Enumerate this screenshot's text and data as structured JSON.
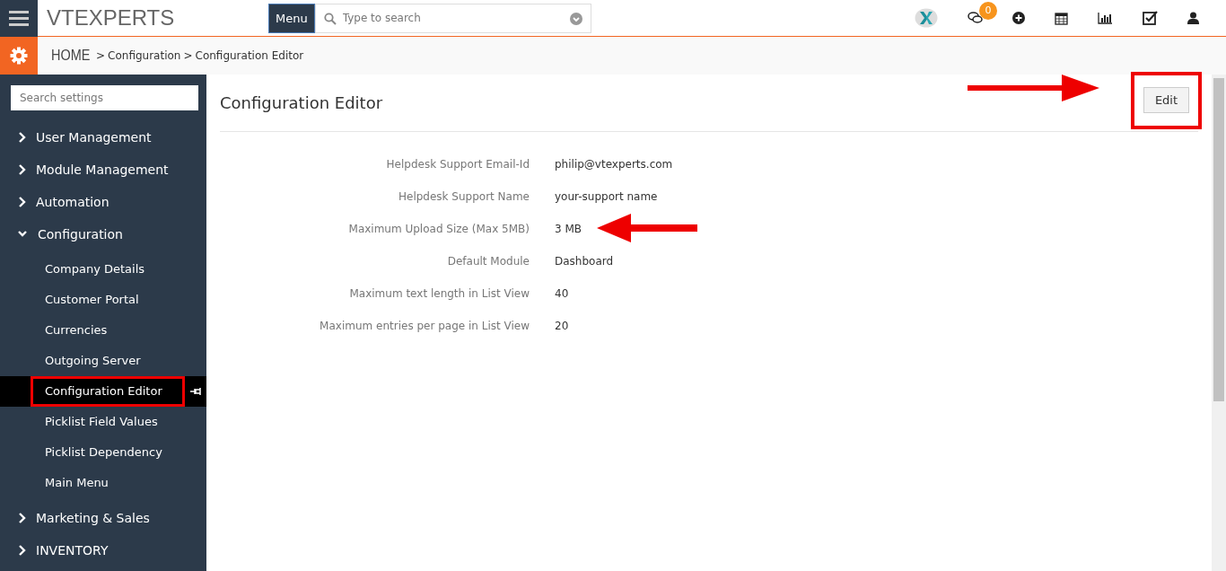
{
  "header": {
    "logo": "VTEXPERTS",
    "menu_button": "Menu",
    "search": {
      "placeholder": "Type to search"
    },
    "notification_count": "0"
  },
  "breadcrumb": {
    "home": "HOME",
    "separator": ">",
    "items": [
      "Configuration",
      "Configuration Editor"
    ]
  },
  "sidebar": {
    "search": {
      "placeholder": "Search settings"
    },
    "sections": [
      {
        "label": "User Management",
        "expanded": false
      },
      {
        "label": "Module Management",
        "expanded": false
      },
      {
        "label": "Automation",
        "expanded": false
      },
      {
        "label": "Configuration",
        "expanded": true,
        "children": [
          {
            "label": "Company Details",
            "selected": false
          },
          {
            "label": "Customer Portal",
            "selected": false
          },
          {
            "label": "Currencies",
            "selected": false
          },
          {
            "label": "Outgoing Server",
            "selected": false
          },
          {
            "label": "Configuration Editor",
            "selected": true
          },
          {
            "label": "Picklist Field Values",
            "selected": false
          },
          {
            "label": "Picklist Dependency",
            "selected": false
          },
          {
            "label": "Main Menu",
            "selected": false
          }
        ]
      },
      {
        "label": "Marketing & Sales",
        "expanded": false
      },
      {
        "label": "INVENTORY",
        "expanded": false
      }
    ]
  },
  "page": {
    "title": "Configuration Editor",
    "edit_button": "Edit",
    "fields": [
      {
        "label": "Helpdesk Support Email-Id",
        "value": "philip@vtexperts.com"
      },
      {
        "label": "Helpdesk Support Name",
        "value": "your-support name"
      },
      {
        "label": "Maximum Upload Size (Max 5MB)",
        "value": "3 MB"
      },
      {
        "label": "Default Module",
        "value": "Dashboard"
      },
      {
        "label": "Maximum text length in List View",
        "value": "40"
      },
      {
        "label": "Maximum entries per page in List View",
        "value": "20"
      }
    ]
  }
}
